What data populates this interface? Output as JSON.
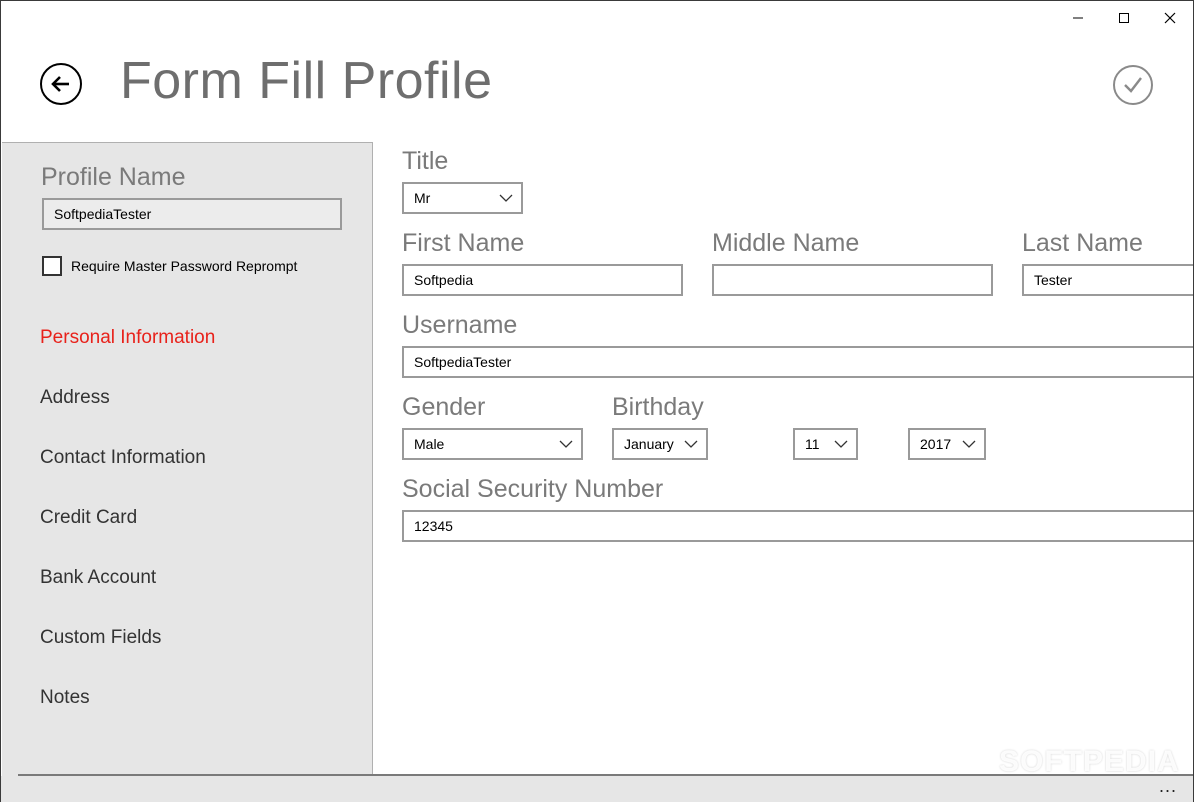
{
  "window": {
    "controls": {
      "minimize": "─",
      "maximize": "☐",
      "close": "✕"
    }
  },
  "header": {
    "title": "Form Fill Profile"
  },
  "sidebar": {
    "profile_name_label": "Profile Name",
    "profile_name_value": "SoftpediaTester",
    "require_reprompt_label": "Require Master Password Reprompt",
    "require_reprompt_checked": false,
    "nav": [
      {
        "label": "Personal Information",
        "active": true
      },
      {
        "label": "Address",
        "active": false
      },
      {
        "label": "Contact Information",
        "active": false
      },
      {
        "label": "Credit Card",
        "active": false
      },
      {
        "label": "Bank Account",
        "active": false
      },
      {
        "label": "Custom Fields",
        "active": false
      },
      {
        "label": "Notes",
        "active": false
      }
    ]
  },
  "form": {
    "title": {
      "label": "Title",
      "value": "Mr"
    },
    "first_name": {
      "label": "First Name",
      "value": "Softpedia"
    },
    "middle_name": {
      "label": "Middle Name",
      "value": ""
    },
    "last_name": {
      "label": "Last Name",
      "value": "Tester"
    },
    "username": {
      "label": "Username",
      "value": "SoftpediaTester"
    },
    "gender": {
      "label": "Gender",
      "value": "Male"
    },
    "birthday": {
      "label": "Birthday",
      "month": "January",
      "day": "11",
      "year": "2017"
    },
    "ssn": {
      "label": "Social Security Number",
      "value": "12345"
    }
  },
  "appbar": {
    "more_label": "..."
  },
  "watermark": "SOFTPEDIA",
  "colors": {
    "accent": "#e8221b",
    "sidebar_bg": "#e6e6e6",
    "label_gray": "#7a7a7a"
  }
}
